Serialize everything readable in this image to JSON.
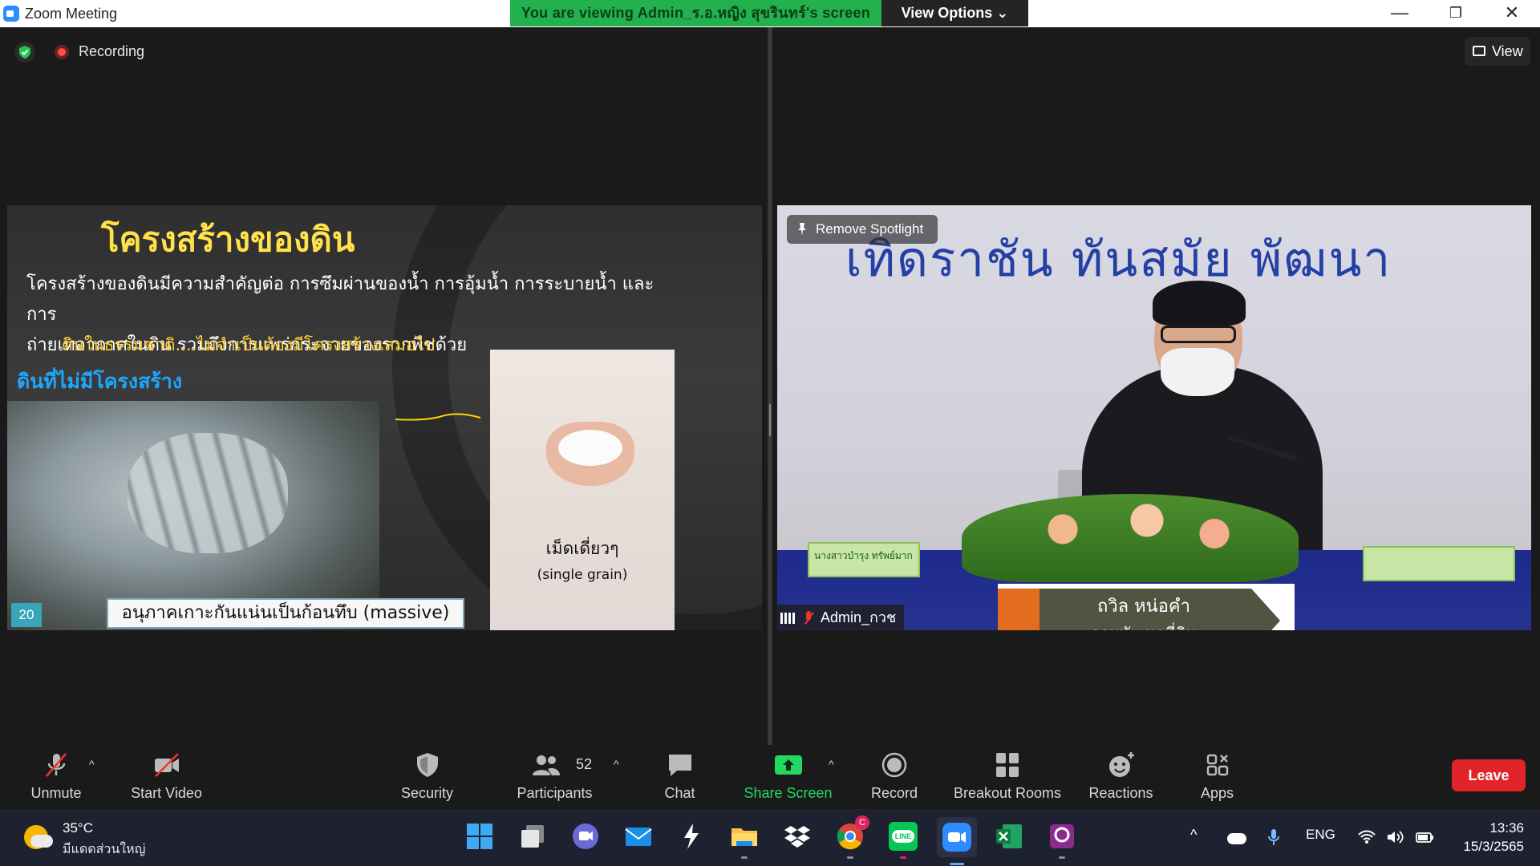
{
  "window": {
    "title": "Zoom Meeting",
    "viewing_banner": "You are viewing Admin_ร.อ.หญิง สุขรินทร์'s screen",
    "view_options": "View Options ⌄",
    "minimize": "—",
    "restore": "❐",
    "close": "✕"
  },
  "meeting": {
    "recording_label": "Recording",
    "view_button": "View"
  },
  "slide": {
    "title": "โครงสร้างของดิน",
    "body_line1": "โครงสร้างของดินมีความสำคัญต่อ การซึมผ่านของน้ำ การอุ้มน้ำ การระบายน้ำ และการ",
    "body_line2": "ถ่ายเทอากาศในดิน รวมถึงการแพร่กระจายของรากพืชด้วย",
    "subtitle": "ดินในธรรมชาติ....ไม่จำเป็นต้องมีโครงสร้างเสมอไป",
    "heading2": "ดินที่ไม่มีโครงสร้าง",
    "sand_caption_th": "เม็ดเดี่ยวๆ",
    "sand_caption_en": "(single grain)",
    "massive_caption": "อนุภาคเกาะกันแน่นเป็นก้อนทึบ (massive)",
    "page_number": "20"
  },
  "speaker": {
    "banner": "เทิดราชัน   ทันสมัย   พัฒนา",
    "remove_spotlight": "Remove Spotlight",
    "nameplate_left": "นางสาวบำรุง ทรัพย์มาก",
    "lower_third_name": "ถวิล  หน่อคำ",
    "lower_third_org": "กรมพัฒนาที่ดิน",
    "name_tag": "Admin_กวช"
  },
  "toolbar": {
    "unmute": "Unmute",
    "start_video": "Start Video",
    "security": "Security",
    "participants": "Participants",
    "participants_count": "52",
    "chat": "Chat",
    "share_screen": "Share Screen",
    "record": "Record",
    "breakout_rooms": "Breakout Rooms",
    "reactions": "Reactions",
    "apps": "Apps",
    "leave": "Leave",
    "caret": "^"
  },
  "taskbar": {
    "weather_temp": "35°C",
    "weather_desc": "มีแดดส่วนใหญ่",
    "language": "ENG",
    "time": "13:36",
    "date": "15/3/2565",
    "tray_chevron": "^",
    "chrome_badge": "C",
    "line_label": "LINE"
  },
  "colors": {
    "zoom_blue": "#2d8cff",
    "banner_green": "#23b14d",
    "leave_red": "#e0242a",
    "share_green": "#23d962",
    "slide_title_yellow": "#ffe14a",
    "slide_heading_blue": "#1ea7ff"
  },
  "icons": {
    "security": "shield-icon",
    "recording": "record-dot-icon",
    "unmute": "muted-mic-icon",
    "start_video": "video-off-icon",
    "participants": "people-icon",
    "chat": "chat-bubble-icon",
    "share_screen": "share-arrow-icon",
    "record": "record-icon",
    "breakout_rooms": "grid-icon",
    "reactions": "smiley-plus-icon",
    "apps": "apps-icon"
  }
}
